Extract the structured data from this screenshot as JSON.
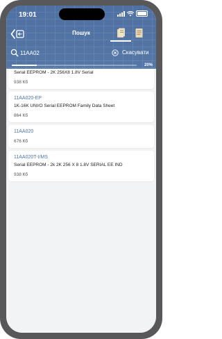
{
  "status_bar": {
    "time": "19:01"
  },
  "header": {
    "title": "Пошук",
    "accent_color": "#4e70a2"
  },
  "search": {
    "value": "11AA02",
    "cancel_label": "Скасувати"
  },
  "progress": {
    "label": "20%",
    "fraction": 0.2
  },
  "results": [
    {
      "name": "",
      "description": "Serial EEPROM - 2K 256X8 1.8V Serial",
      "size": "938 Кб"
    },
    {
      "name": "11AA020-EP",
      "description": "1K-16K UNI/O Serial EEPROM Family Data Sheet",
      "size": "864 Кб"
    },
    {
      "name": "11AA020",
      "description": "",
      "size": "676 Кб"
    },
    {
      "name": "11AA020T-I/MS",
      "description": "Serial EEPROM - 2k 2K 256 X 8 1.8V SERIAL EE IND",
      "size": "938 Кб"
    }
  ]
}
